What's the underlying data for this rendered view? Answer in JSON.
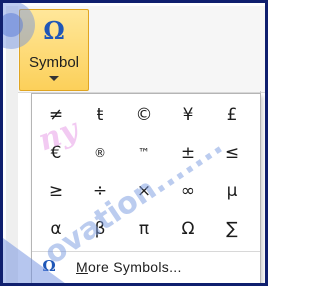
{
  "symbol_button": {
    "icon_glyph": "Ω",
    "label": "Symbol",
    "icon_name": "omega-icon"
  },
  "dropdown": {
    "symbols": [
      [
        "≠",
        "ŧ",
        "©",
        "¥",
        "£"
      ],
      [
        "€",
        "®",
        "™",
        "±",
        "≤"
      ],
      [
        "≥",
        "÷",
        "×",
        "∞",
        "µ"
      ],
      [
        "α",
        "β",
        "π",
        "Ω",
        "∑"
      ]
    ],
    "more_symbols": {
      "icon_glyph": "Ω",
      "label": "More Symbols..."
    }
  },
  "colors": {
    "button_fill": "#fcd05a",
    "omega_blue": "#1f57b8",
    "frame_border": "#0f1f6e",
    "watermark": "#7a9ae0"
  },
  "watermark": {
    "text_left": "ny",
    "text_main": "ovation.......",
    "shapes_visible": true
  }
}
